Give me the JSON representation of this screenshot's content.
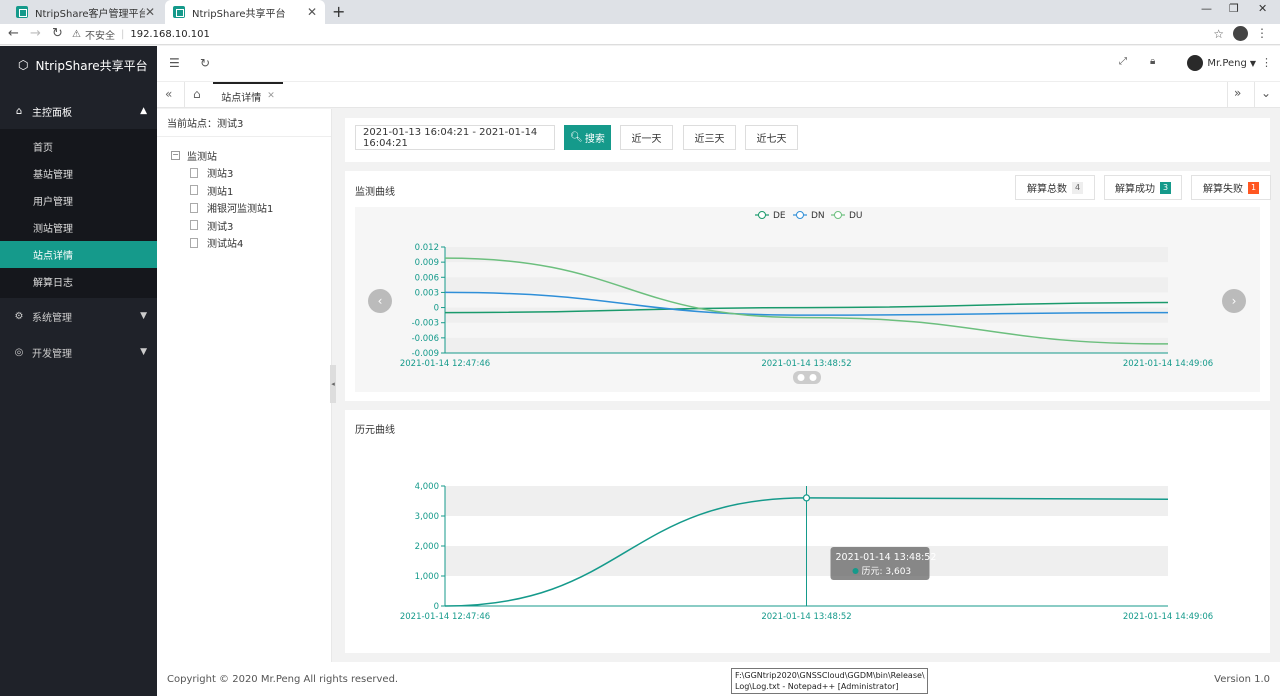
{
  "browser": {
    "tabs": [
      {
        "title": "NtripShare客户管理平台"
      },
      {
        "title": "NtripShare共享平台"
      }
    ],
    "insecure_label": "不安全",
    "url": "192.168.10.101"
  },
  "sidebar": {
    "brand": "NtripShare共享平台",
    "groups": [
      {
        "label": "主控面板"
      },
      {
        "label": "系统管理"
      },
      {
        "label": "开发管理"
      }
    ],
    "items": [
      {
        "label": "首页"
      },
      {
        "label": "基站管理"
      },
      {
        "label": "用户管理"
      },
      {
        "label": "测站管理"
      },
      {
        "label": "站点详情"
      },
      {
        "label": "解算日志"
      }
    ]
  },
  "topbar": {
    "user": "Mr.Peng"
  },
  "tabbar": {
    "active_tab": "站点详情"
  },
  "tree": {
    "current_label": "当前站点：测试3",
    "root": "监测站",
    "leaves": [
      "测站3",
      "测站1",
      "湘银河监测站1",
      "测试3",
      "测试站4"
    ]
  },
  "search": {
    "daterange": "2021-01-13 16:04:21 - 2021-01-14 16:04:21",
    "search_label": "搜索",
    "ranges": [
      "近一天",
      "近三天",
      "近七天"
    ]
  },
  "monitor": {
    "title": "监测曲线",
    "stats": [
      {
        "label": "解算总数",
        "count": "4"
      },
      {
        "label": "解算成功",
        "count": "3"
      },
      {
        "label": "解算失败",
        "count": "1"
      }
    ]
  },
  "epoch": {
    "title": "历元曲线",
    "tooltip_time": "2021-01-14 13:48:52",
    "tooltip_value": "历元: 3,603"
  },
  "footer": {
    "copyright": "Copyright © 2020 Mr.Peng All rights reserved.",
    "version": "Version 1.0"
  },
  "taskbar_tip": {
    "line1": "F:\\GGNtrip2020\\GNSSCloud\\GGDM\\bin\\Release\\",
    "line2": "Log\\Log.txt - Notepad++ [Administrator]"
  },
  "chart_data": [
    {
      "type": "line",
      "x": [
        "2021-01-14 12:47:46",
        "2021-01-14 13:48:52",
        "2021-01-14 14:49:06"
      ],
      "series": [
        {
          "name": "DE",
          "color": "#1a9a6c",
          "values": [
            -0.001,
            0.0,
            0.001
          ]
        },
        {
          "name": "DN",
          "color": "#2f8fd8",
          "values": [
            0.003,
            -0.0015,
            -0.001
          ]
        },
        {
          "name": "DU",
          "color": "#6cbf7e",
          "values": [
            0.0098,
            -0.002,
            -0.0072
          ]
        }
      ],
      "ylim": [
        -0.009,
        0.012
      ],
      "yticks": [
        "0.012",
        "0.009",
        "0.006",
        "0.003",
        "0",
        "-0.003",
        "-0.006",
        "-0.009"
      ],
      "xticks": [
        "2021-01-14 12:47:46",
        "2021-01-14 13:48:52",
        "2021-01-14 14:49:06"
      ],
      "legend": "top-center"
    },
    {
      "type": "line",
      "x": [
        "2021-01-14 12:47:46",
        "2021-01-14 13:48:52",
        "2021-01-14 14:49:06"
      ],
      "series": [
        {
          "name": "历元",
          "color": "#159a8b",
          "values": [
            0,
            3603,
            3560
          ]
        }
      ],
      "ylim": [
        0,
        4000
      ],
      "yticks": [
        "4,000",
        "3,000",
        "2,000",
        "1,000",
        "0"
      ],
      "xticks": [
        "2021-01-14 12:47:46",
        "2021-01-14 13:48:52",
        "2021-01-14 14:49:06"
      ]
    }
  ]
}
